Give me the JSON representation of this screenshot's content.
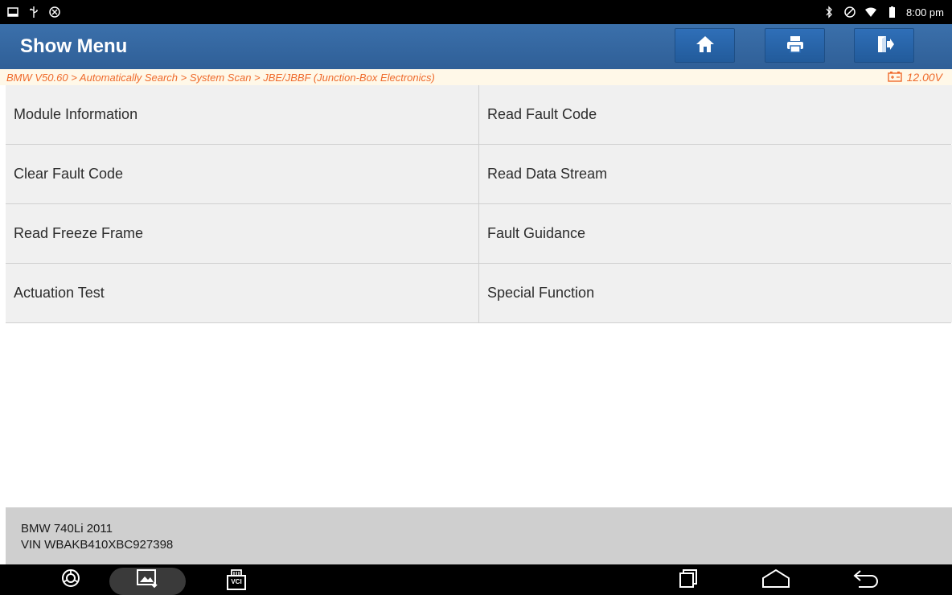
{
  "status_bar": {
    "time": "8:00 pm",
    "left_icons": [
      "screenshot-notification-icon",
      "usb-icon",
      "settings-icon"
    ],
    "right_icons": [
      "bluetooth-icon",
      "do-not-disturb-icon",
      "wifi-icon",
      "battery-icon"
    ]
  },
  "header": {
    "title": "Show Menu",
    "buttons": [
      "home-icon",
      "print-icon",
      "exit-icon"
    ]
  },
  "breadcrumb": {
    "path": "BMW V50.60 > Automatically Search > System Scan > JBE/JBBF (Junction-Box Electronics)",
    "voltage": "12.00V"
  },
  "menu": {
    "items": [
      "Module Information",
      "Read Fault Code",
      "Clear Fault Code",
      "Read Data Stream",
      "Read Freeze Frame",
      "Fault Guidance",
      "Actuation Test",
      "Special Function"
    ]
  },
  "vehicle": {
    "model": "BMW 740Li 2011",
    "vin": "VIN WBAKB410XBC927398"
  },
  "nav_bar": {
    "left": [
      "browser-icon",
      "screenshot-icon",
      "vci-icon"
    ],
    "vci_label": "VCI",
    "right": [
      "recents-icon",
      "home-nav-icon",
      "back-icon"
    ]
  },
  "colors": {
    "header_blue": "#2f5f97",
    "breadcrumb_orange": "#ef6a2b",
    "breadcrumb_bg": "#fff8e8",
    "menu_cell_bg": "#f0f0f0",
    "vehicle_bar_bg": "#cfcfcf"
  }
}
